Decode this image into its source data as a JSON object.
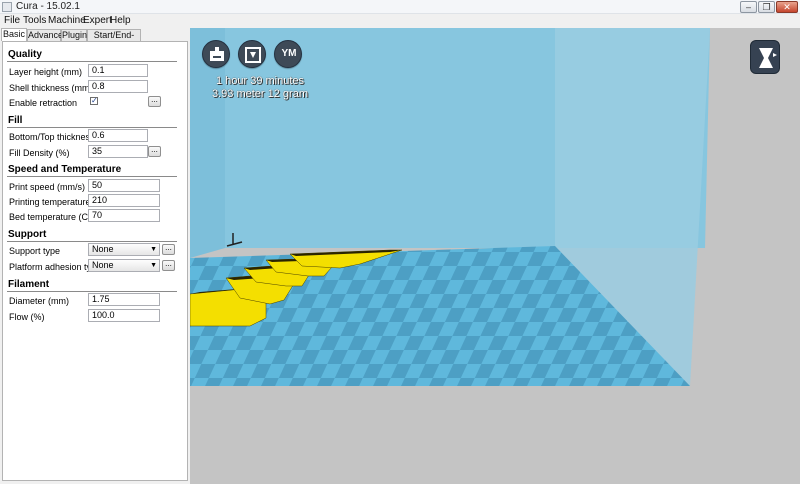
{
  "window": {
    "title": "Cura - 15.02.1",
    "minimize_icon": "minimize-icon",
    "restore_icon": "restore-icon",
    "close_icon": "close-icon"
  },
  "menu": [
    "File",
    "Tools",
    "Machine",
    "Expert",
    "Help"
  ],
  "tabs": [
    "Basic",
    "Advanced",
    "Plugins",
    "Start/End-GCode"
  ],
  "settings": {
    "quality": {
      "title": "Quality",
      "layer_height": {
        "label": "Layer height (mm)",
        "value": "0.1"
      },
      "shell_thickness": {
        "label": "Shell thickness (mm)",
        "value": "0.8"
      },
      "enable_retraction": {
        "label": "Enable retraction",
        "checked": true
      }
    },
    "fill": {
      "title": "Fill",
      "bottom_top_thickness": {
        "label": "Bottom/Top thickness (mm)",
        "value": "0.6"
      },
      "fill_density": {
        "label": "Fill Density (%)",
        "value": "35"
      }
    },
    "speed_temp": {
      "title": "Speed and Temperature",
      "print_speed": {
        "label": "Print speed (mm/s)",
        "value": "50"
      },
      "printing_temperature": {
        "label": "Printing temperature (C)",
        "value": "210"
      },
      "bed_temperature": {
        "label": "Bed temperature (C)",
        "value": "70"
      }
    },
    "support": {
      "title": "Support",
      "support_type": {
        "label": "Support type",
        "value": "None"
      },
      "platform_adhesion": {
        "label": "Platform adhesion type",
        "value": "None"
      }
    },
    "filament": {
      "title": "Filament",
      "diameter": {
        "label": "Diameter (mm)",
        "value": "1.75"
      },
      "flow": {
        "label": "Flow (%)",
        "value": "100.0"
      }
    }
  },
  "more_button_label": "...",
  "viewport": {
    "print_time": "1 hour 39 minutes",
    "material_usage": "3.93 meter 12 gram",
    "ym_label": "YM",
    "buttons": {
      "load_icon": "load-model-icon",
      "save_icon": "save-toolpath-icon",
      "viewmode_icon": "view-mode-icon"
    },
    "colors": {
      "build_volume": "#7bc0dc",
      "platform_light": "#5fb8dc",
      "platform_dark": "#4d9fc4",
      "model": "#f4df00",
      "background": "#c4c4c4"
    }
  }
}
